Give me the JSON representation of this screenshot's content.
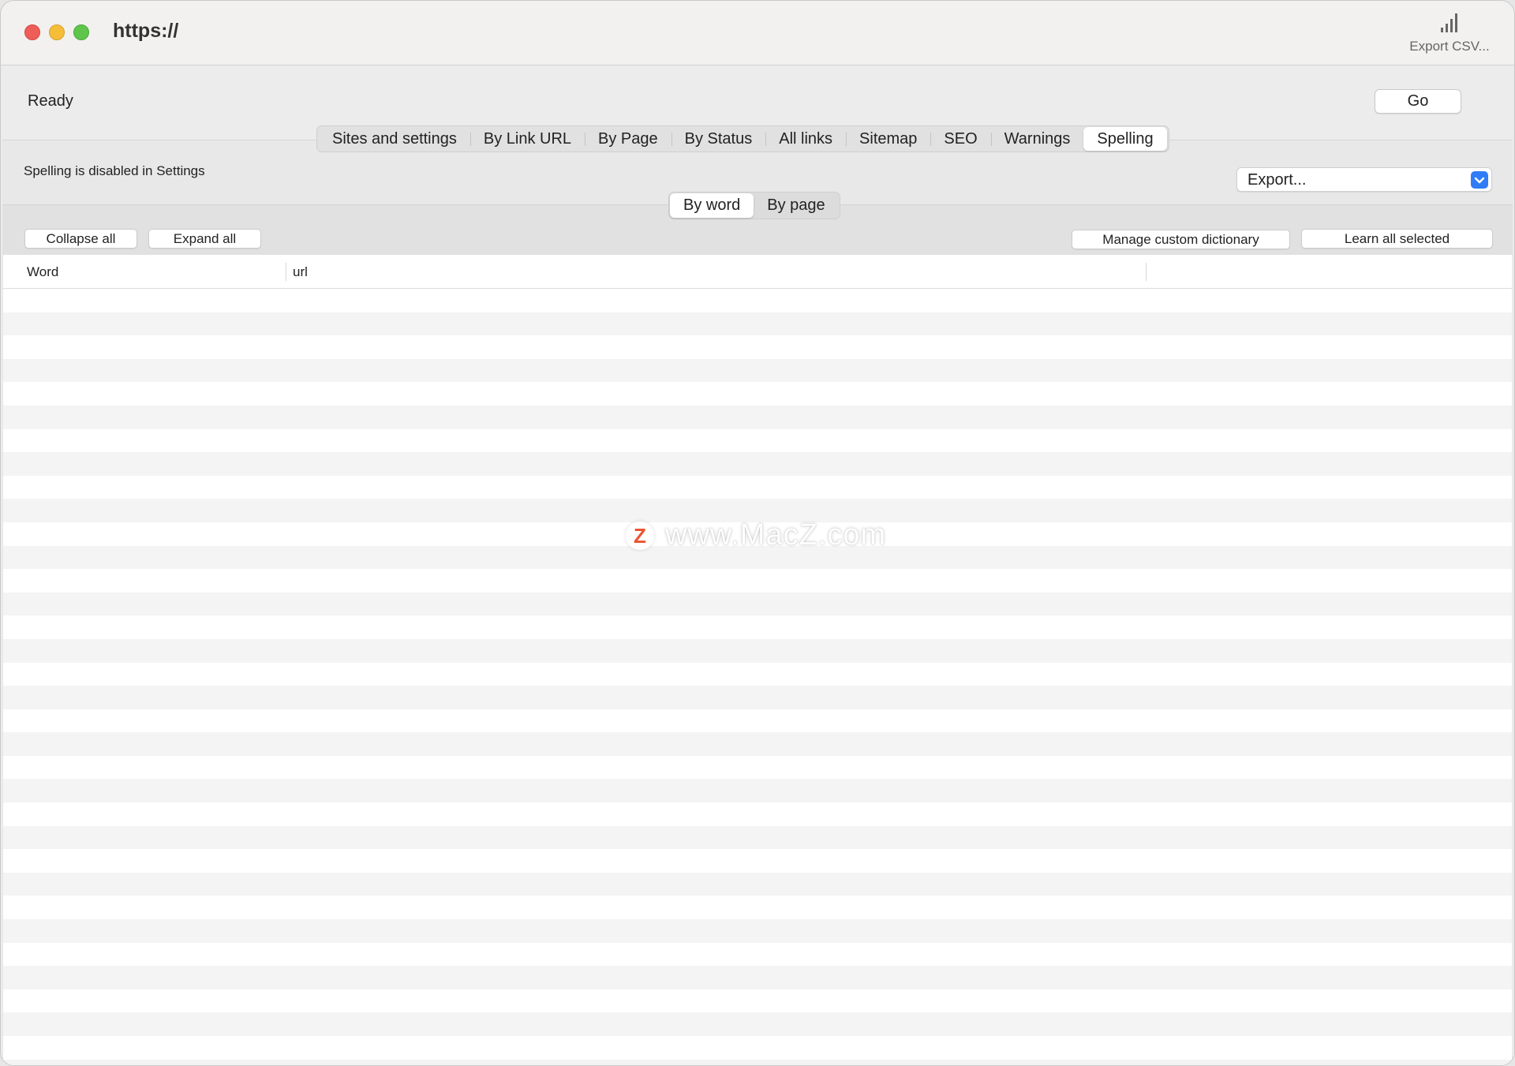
{
  "window": {
    "title": "https://",
    "toolbar": {
      "export_csv_label": "Export CSV..."
    }
  },
  "status": {
    "text": "Ready",
    "go_label": "Go"
  },
  "tabs": [
    {
      "label": "Sites and settings"
    },
    {
      "label": "By Link URL"
    },
    {
      "label": "By Page"
    },
    {
      "label": "By Status"
    },
    {
      "label": "All links"
    },
    {
      "label": "Sitemap"
    },
    {
      "label": "SEO"
    },
    {
      "label": "Warnings"
    },
    {
      "label": "Spelling",
      "active": true
    }
  ],
  "spelling": {
    "notice": "Spelling is disabled in Settings",
    "export_select": {
      "value": "Export..."
    },
    "view_toggle": [
      {
        "label": "By word",
        "active": true
      },
      {
        "label": "By page"
      }
    ],
    "buttons": {
      "collapse_all": "Collapse all",
      "expand_all": "Expand all",
      "manage_dictionary": "Manage custom dictionary",
      "learn_all_selected": "Learn all selected"
    },
    "table": {
      "columns": [
        "Word",
        "url",
        ""
      ],
      "rows": []
    }
  },
  "watermark": {
    "logo_letter": "Z",
    "text": "www.MacZ.com"
  },
  "colors": {
    "close": "#ee5d57",
    "minimize": "#f5bd38",
    "zoom": "#5fc54b",
    "accent": "#2f7cf6"
  }
}
